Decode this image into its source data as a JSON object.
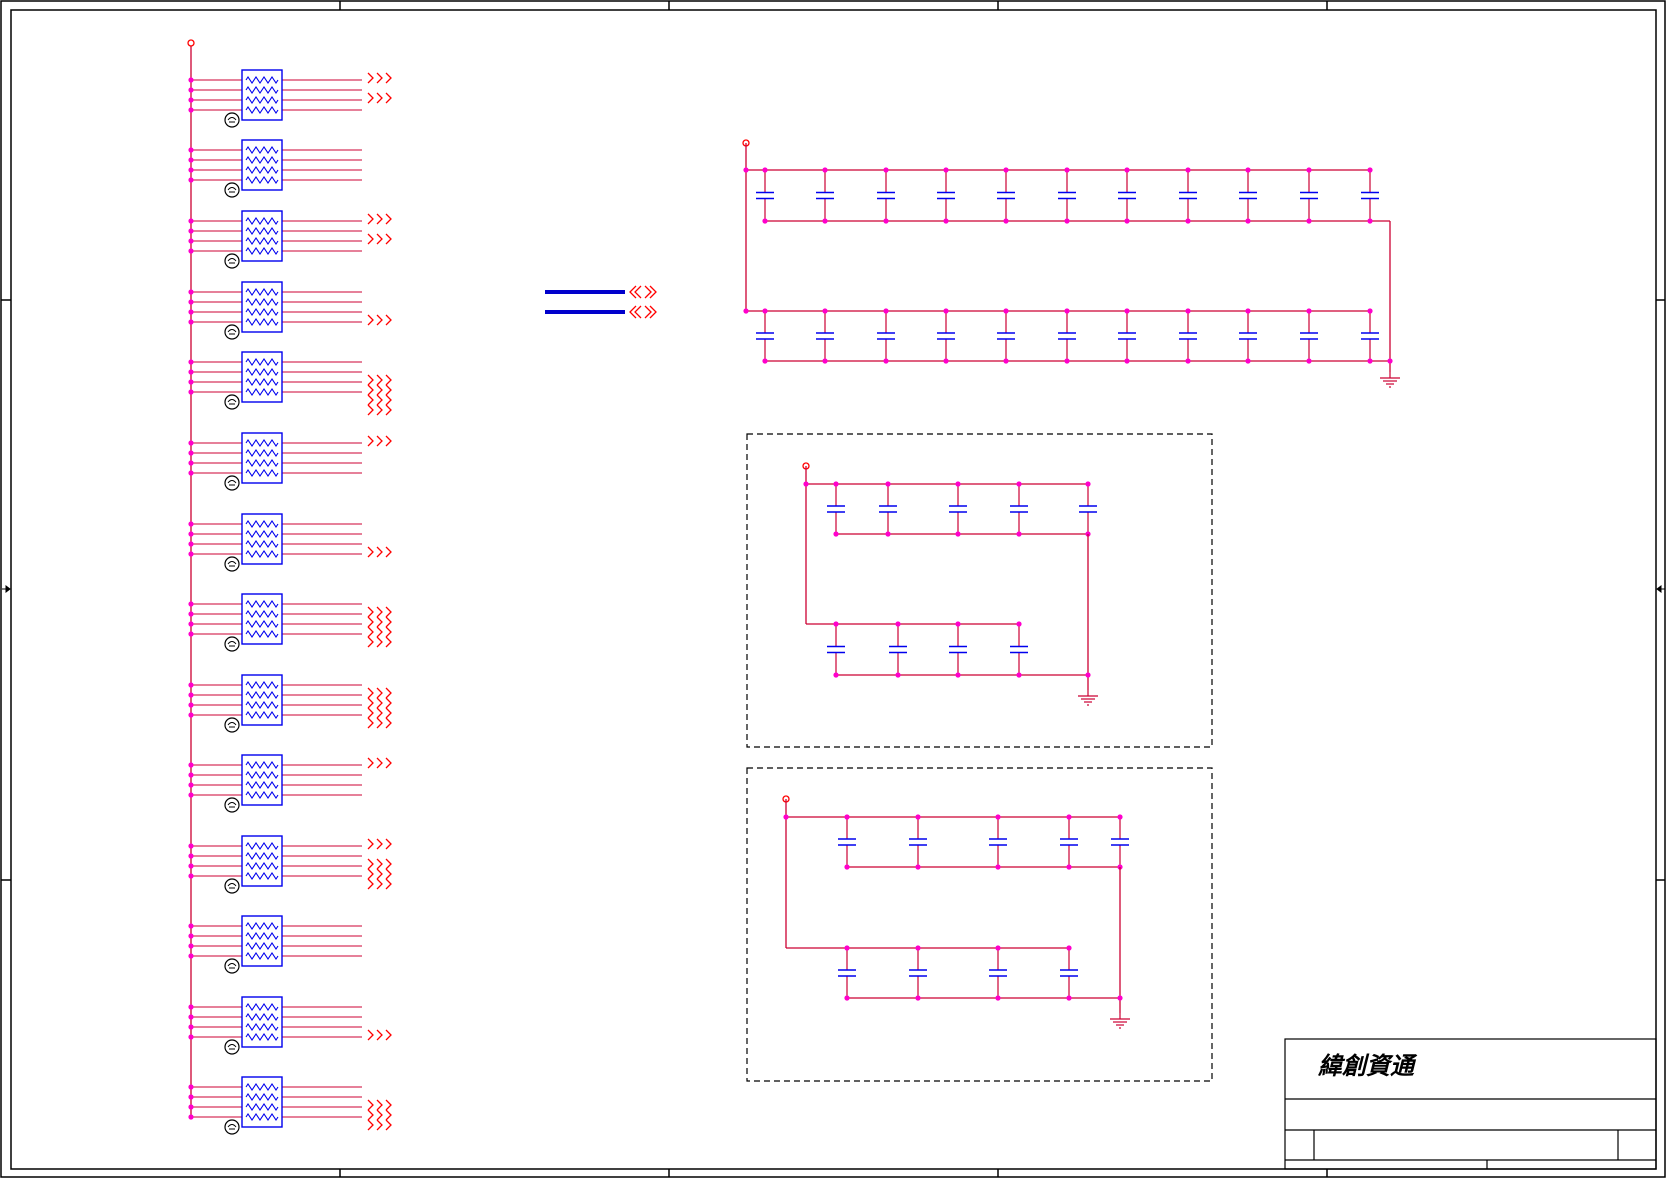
{
  "title_block": {
    "company": "緯創資通"
  },
  "colors": {
    "wire": "#cc0033",
    "node": "#ff00cc",
    "component": "#0000ee",
    "offpage": "#ff0000",
    "border": "#000000",
    "bus": "#0000cc"
  },
  "icons": {
    "resistor_network": "rpack-zigzag-icon",
    "ground": "ground-icon",
    "power_port": "power-port-circle-icon",
    "offpage_connector": "offpage-chevron-icon",
    "capacitor": "capacitor-icon"
  },
  "schematic": {
    "rpack_count": 14,
    "top_cap_rows": 2,
    "caps_per_top_row": 11,
    "box1_caps_row1": 5,
    "box1_caps_row2": 4,
    "box2_caps_row1": 5,
    "box2_caps_row2": 4
  }
}
